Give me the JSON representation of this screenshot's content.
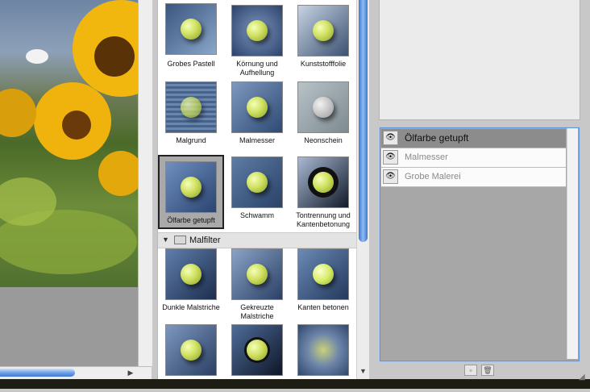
{
  "gallery": {
    "filters_top": [
      {
        "name": "Grobes Pastell"
      },
      {
        "name": "Körnung und Aufhellung"
      },
      {
        "name": "Kunststofffolie"
      },
      {
        "name": "Malgrund"
      },
      {
        "name": "Malmesser"
      },
      {
        "name": "Neonschein"
      },
      {
        "name": "Ölfarbe getupft",
        "selected": true
      },
      {
        "name": "Schwamm"
      },
      {
        "name": "Tontrennung und Kantenbetonung"
      }
    ],
    "category": {
      "name": "Malfilter",
      "expanded": true
    },
    "filters_malfilter": [
      {
        "name": "Dunkle Malstriche"
      },
      {
        "name": "Gekreuzte Malstriche"
      },
      {
        "name": "Kanten betonen"
      },
      {
        "name": ""
      },
      {
        "name": ""
      },
      {
        "name": ""
      }
    ]
  },
  "layers": {
    "items": [
      {
        "name": "Ölfarbe getupft",
        "active": true
      },
      {
        "name": "Malmesser",
        "active": false
      },
      {
        "name": "Grobe Malerei",
        "active": false
      }
    ]
  },
  "icons": {
    "eye": "eye-icon",
    "folder": "folder-icon",
    "disclosure": "disclosure-triangle-icon",
    "new_layer": "new-effect-layer-icon",
    "delete": "trash-icon"
  },
  "colors": {
    "selection_border": "#222222",
    "scroll_accent": "#3f7bd3",
    "panel_focus": "#5c93df"
  }
}
